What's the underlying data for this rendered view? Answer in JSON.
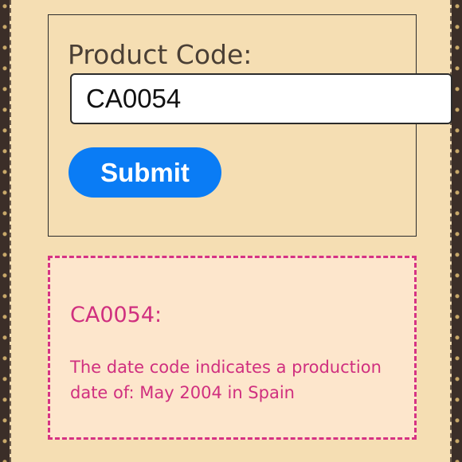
{
  "form": {
    "label": "Product Code:",
    "input_value": "CA0054",
    "submit_label": "Submit"
  },
  "result": {
    "code_heading": "CA0054:",
    "message": "The date code indicates a production date of: May 2004 in Spain"
  },
  "colors": {
    "page_background": "#f5deb3",
    "button": "#0a7cf5",
    "result_text": "#d02f7f",
    "result_border": "#d63384",
    "result_background": "#fde6cc"
  }
}
